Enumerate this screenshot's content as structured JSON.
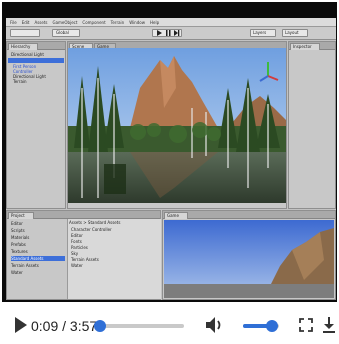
{
  "editor": {
    "menu": [
      "File",
      "Edit",
      "Assets",
      "GameObject",
      "Component",
      "Terrain",
      "Window",
      "Help"
    ],
    "toolbar": {
      "global_label": "Global",
      "layers_label": "Layers",
      "layout_label": "Layout"
    },
    "hierarchy": {
      "tab": "Hierarchy",
      "items": [
        "Directional Light",
        "First Person",
        "Controller",
        "Directional Light",
        "Terrain"
      ]
    },
    "scene_tab": "Scene",
    "game_tab": "Game",
    "inspector_tab": "Inspector",
    "project": {
      "tab": "Project",
      "breadcrumb": "Assets > Standard Assets",
      "folders": [
        "Editor",
        "Scripts",
        "Materials",
        "Prefabs",
        "Textures",
        "Standard Assets",
        "Terrain Assets",
        "Water"
      ],
      "files": [
        "Character Controller",
        "Editor",
        "Fonts",
        "Particles",
        "Sky",
        "Terrain Assets",
        "Water"
      ]
    },
    "preview_tab": "Game"
  },
  "player": {
    "current_time": "0:09",
    "duration": "3:57",
    "time_display": "0:09 / 3:57",
    "progress_fraction": 0.04,
    "volume_fraction": 0.8,
    "accent_color": "#2f6fd6",
    "icons": {
      "play": "play-icon",
      "volume": "volume-icon",
      "fullscreen": "fullscreen-icon",
      "download": "download-icon"
    }
  }
}
